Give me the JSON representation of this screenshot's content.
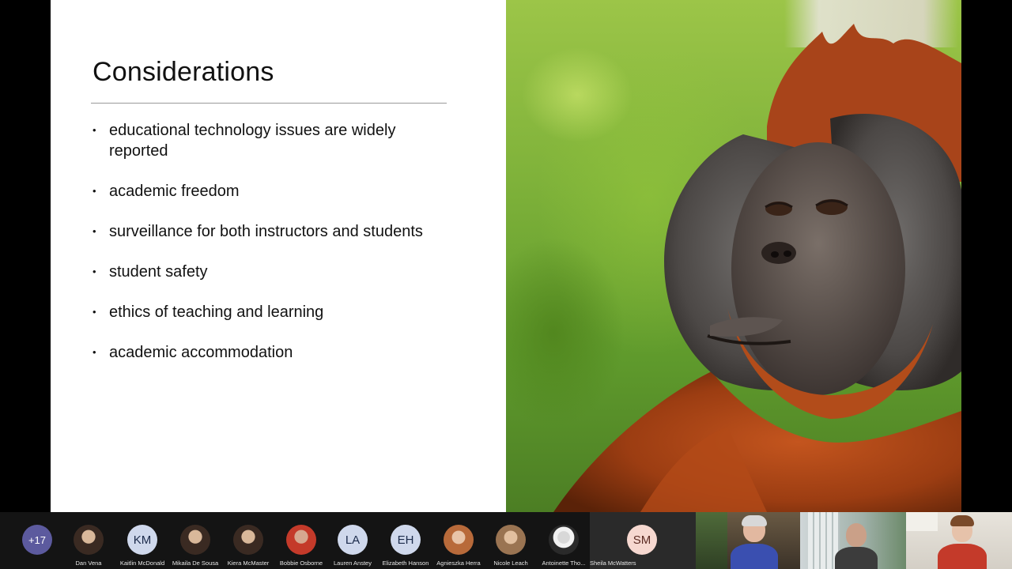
{
  "slide": {
    "title": "Considerations",
    "bullets": [
      "educational technology issues are widely reported",
      "academic freedom",
      "surveillance for both instructors and students",
      "student safety",
      "ethics of teaching and learning",
      "academic accommodation"
    ]
  },
  "participants": {
    "overflow_label": "+17",
    "people": [
      {
        "name": "Dan Vena",
        "initials": "",
        "type": "photo"
      },
      {
        "name": "Kaitlin McDonald",
        "initials": "KM",
        "type": "initials"
      },
      {
        "name": "Mikaila De Sousa",
        "initials": "",
        "type": "photo"
      },
      {
        "name": "Kiera McMaster",
        "initials": "",
        "type": "photo"
      },
      {
        "name": "Bobbie Osborne",
        "initials": "",
        "type": "photo"
      },
      {
        "name": "Lauren Anstey",
        "initials": "LA",
        "type": "initials"
      },
      {
        "name": "Elizabeth Hanson",
        "initials": "EH",
        "type": "initials"
      },
      {
        "name": "Agnieszka Herra",
        "initials": "",
        "type": "photo"
      },
      {
        "name": "Nicole Leach",
        "initials": "",
        "type": "photo"
      },
      {
        "name": "Antoinette Tho...",
        "initials": "",
        "type": "photo"
      }
    ],
    "active_speaker": {
      "name": "Sheila McWatters",
      "initials": "SM"
    }
  },
  "colors": {
    "overflow_badge": "#5c5a9e",
    "initials_bg": "#cfd8ec",
    "slide_bg": "#ffffff"
  }
}
